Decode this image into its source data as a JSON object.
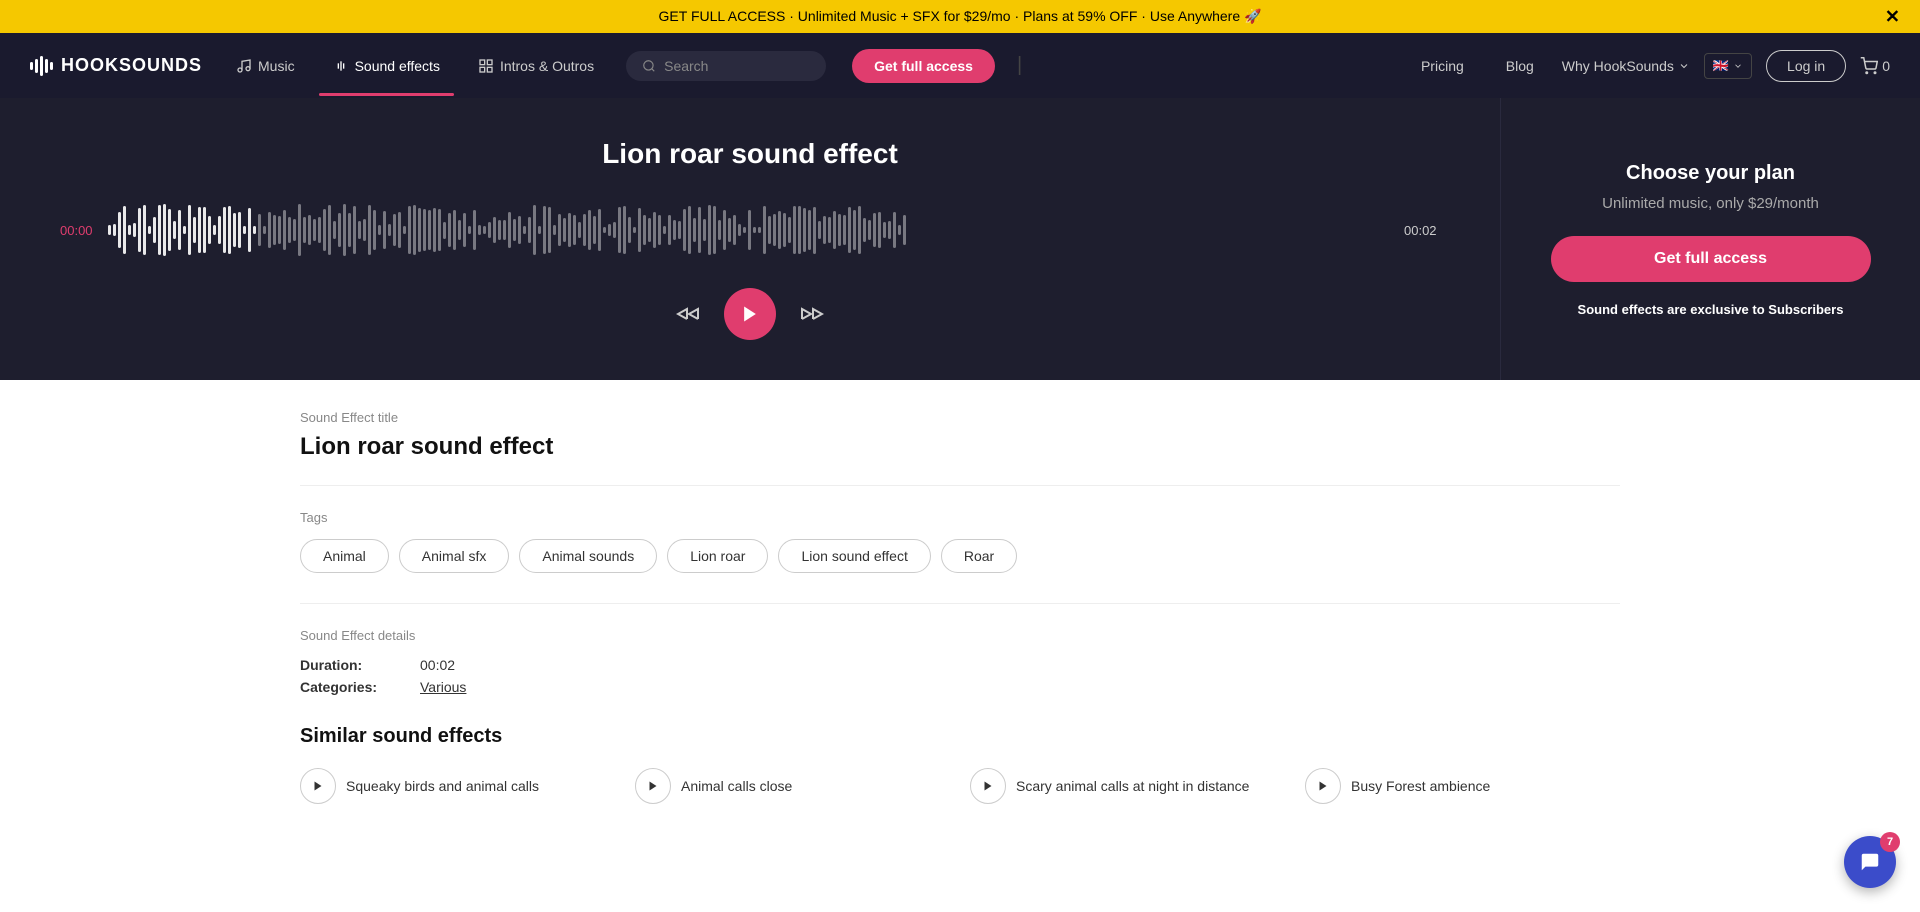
{
  "banner": {
    "text": "GET FULL ACCESS · Unlimited Music + SFX for $29/mo · Plans at 59% OFF · Use Anywhere 🚀",
    "close_label": "✕"
  },
  "navbar": {
    "logo_text": "HOOKSOUNDS",
    "music_label": "Music",
    "sound_effects_label": "Sound effects",
    "intros_outros_label": "Intros & Outros",
    "search_placeholder": "Search",
    "get_full_access_label": "Get full access",
    "pricing_label": "Pricing",
    "blog_label": "Blog",
    "why_label": "Why HookSounds",
    "flag": "🇬🇧",
    "login_label": "Log in",
    "cart_label": "0"
  },
  "hero": {
    "title": "Lion roar sound effect",
    "time_start": "00:00",
    "time_end": "00:02",
    "choose_plan_title": "Choose your plan",
    "choose_plan_subtitle": "Unlimited music, only $29/month",
    "get_full_access_label": "Get full access",
    "exclusive_note": "Sound effects are exclusive to Subscribers"
  },
  "detail": {
    "section_label": "Sound Effect title",
    "title": "Lion roar sound effect",
    "tags_label": "Tags",
    "tags": [
      "Animal",
      "Animal sfx",
      "Animal sounds",
      "Lion roar",
      "Lion sound effect",
      "Roar"
    ],
    "details_label": "Sound Effect details",
    "duration_key": "Duration:",
    "duration_value": "00:02",
    "categories_key": "Categories:",
    "categories_value": "Various"
  },
  "similar": {
    "title": "Similar sound effects",
    "items": [
      {
        "name": "Squeaky birds and animal calls"
      },
      {
        "name": "Animal calls close"
      },
      {
        "name": "Scary animal calls at night in distance"
      },
      {
        "name": "Busy Forest ambience"
      }
    ]
  },
  "chat": {
    "badge": "7"
  }
}
